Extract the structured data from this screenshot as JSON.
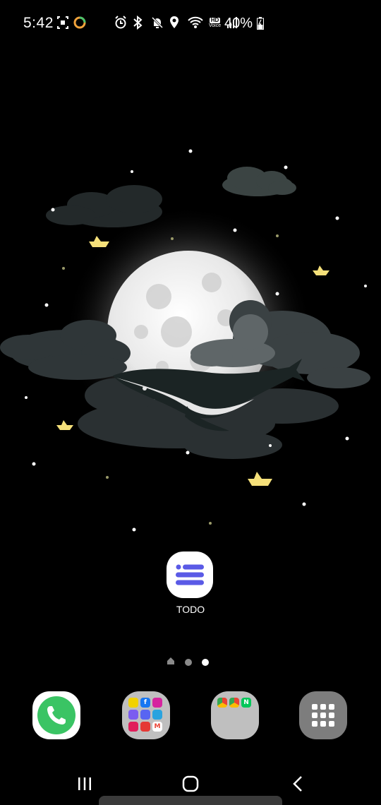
{
  "status_bar": {
    "time": "5:42",
    "battery_percent": "40%",
    "left_icons": [
      "screenshot-icon",
      "edge-panel-icon"
    ],
    "right_icons": [
      "alarm-icon",
      "bluetooth-icon",
      "mute-icon",
      "location-icon",
      "wifi-icon",
      "volte-icon",
      "signal-icon"
    ],
    "volte_label": "HD",
    "volte_sub": "Voice"
  },
  "home": {
    "apps": [
      {
        "label": "TODO",
        "icon": "todo-list-icon",
        "color": "#5a5ae6"
      }
    ],
    "page_indicator": {
      "pages": 3,
      "active": 2,
      "first_is_home": true
    }
  },
  "dock": {
    "items": [
      {
        "name": "phone",
        "icon": "phone-icon",
        "color": "#3ac464"
      },
      {
        "name": "social-folder",
        "icon": "folder-icon"
      },
      {
        "name": "browser-folder",
        "icon": "folder-icon"
      },
      {
        "name": "apps",
        "icon": "apps-grid-icon"
      }
    ]
  },
  "nav_bar": {
    "buttons": [
      "recents-icon",
      "home-icon",
      "back-icon"
    ]
  }
}
